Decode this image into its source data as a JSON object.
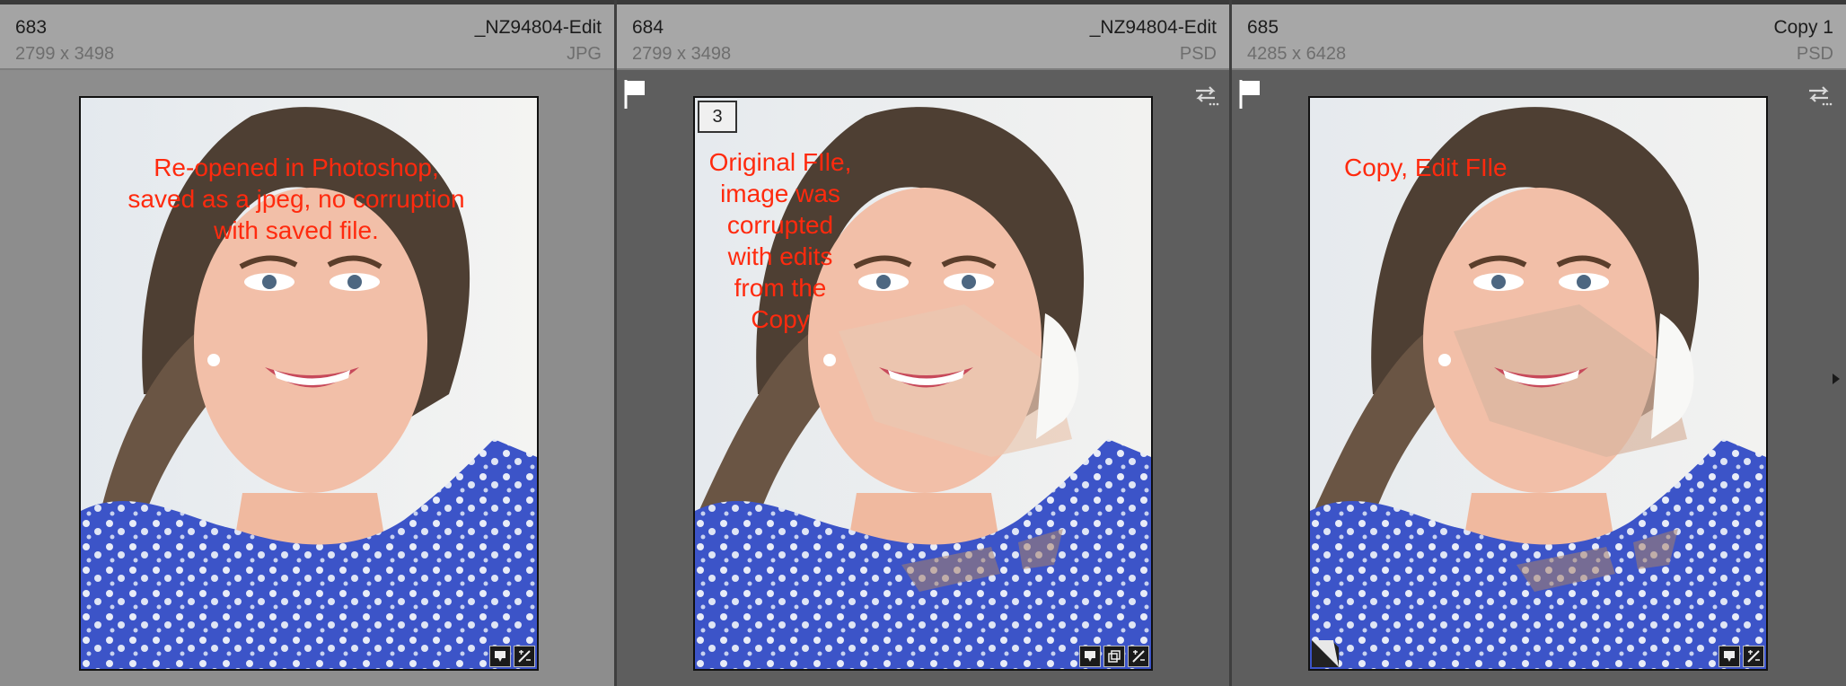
{
  "cells": [
    {
      "index": "683",
      "name": "_NZ94804-Edit",
      "dims": "2799 x 3498",
      "ext": "JPG",
      "selected": true,
      "overlay": "Re-opened in Photoshop,\nsaved as a jpeg, no corruption\nwith saved file."
    },
    {
      "index": "684",
      "name": "_NZ94804-Edit",
      "dims": "2799 x 3498",
      "ext": "PSD",
      "selected": false,
      "stack_count": "3",
      "overlay": "Original FIle,\nimage was\ncorrupted\nwith edits\nfrom the\nCopy"
    },
    {
      "index": "685",
      "name": "Copy 1",
      "dims": "4285 x 6428",
      "ext": "PSD",
      "selected": false,
      "overlay": "Copy, Edit FIle"
    }
  ],
  "icons": {
    "flag": "flag-icon",
    "sync": "sync-icon",
    "comment": "comment-icon",
    "crop": "crop-icon",
    "develop": "develop-adjust-icon",
    "next": "arrow-right-icon"
  },
  "colors": {
    "annotation": "#ff2a0e",
    "selected_cell": "#8d8d8d",
    "cell": "#5e5e5e",
    "header": "#a4a4a4"
  }
}
